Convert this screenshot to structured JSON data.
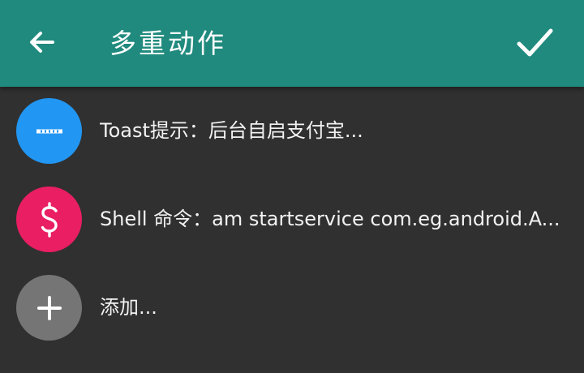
{
  "appbar": {
    "title": "多重动作",
    "back_icon": "arrow-left-icon",
    "confirm_icon": "check-icon",
    "background_color": "#208a7e"
  },
  "actions": [
    {
      "icon": "dots-icon",
      "icon_color": "#2196f3",
      "label": "Toast提示：后台自启支付宝..."
    },
    {
      "icon": "dollar-icon",
      "icon_color": "#e91e63",
      "label": "Shell 命令：am startservice com.eg.android.A..."
    }
  ],
  "add_item": {
    "icon": "plus-icon",
    "icon_color": "#757575",
    "label": "添加..."
  }
}
